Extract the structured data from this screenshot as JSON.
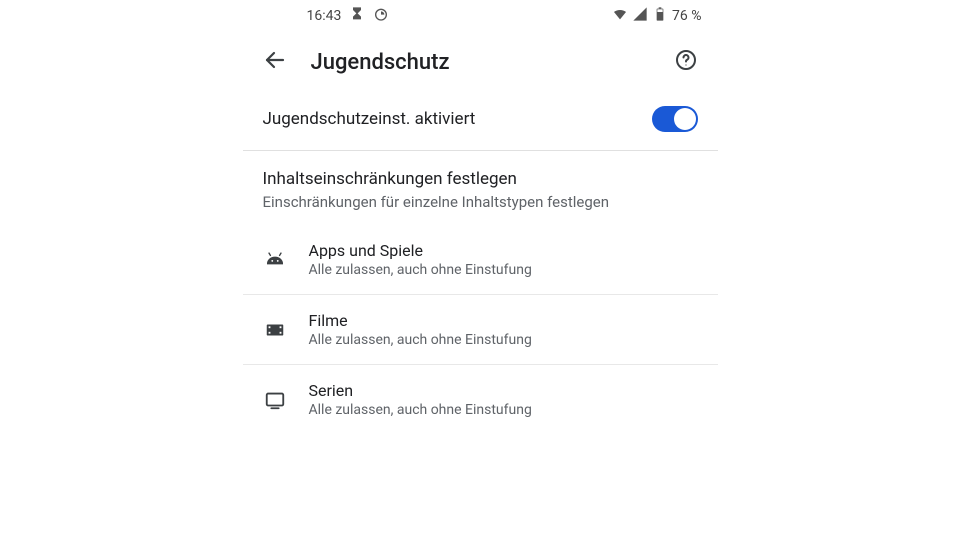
{
  "statusbar": {
    "time": "16:43",
    "battery": "76 %"
  },
  "appbar": {
    "title": "Jugendschutz"
  },
  "toggle": {
    "label": "Jugendschutzeinst. aktiviert",
    "on": true
  },
  "section": {
    "title": "Inhaltseinschränkungen festlegen",
    "subtitle": "Einschränkungen für einzelne Inhaltstypen festlegen"
  },
  "items": [
    {
      "icon": "android",
      "title": "Apps und Spiele",
      "subtitle": "Alle zulassen, auch ohne Einstufung"
    },
    {
      "icon": "film",
      "title": "Filme",
      "subtitle": "Alle zulassen, auch ohne Einstufung"
    },
    {
      "icon": "tv",
      "title": "Serien",
      "subtitle": "Alle zulassen, auch ohne Einstufung"
    }
  ]
}
